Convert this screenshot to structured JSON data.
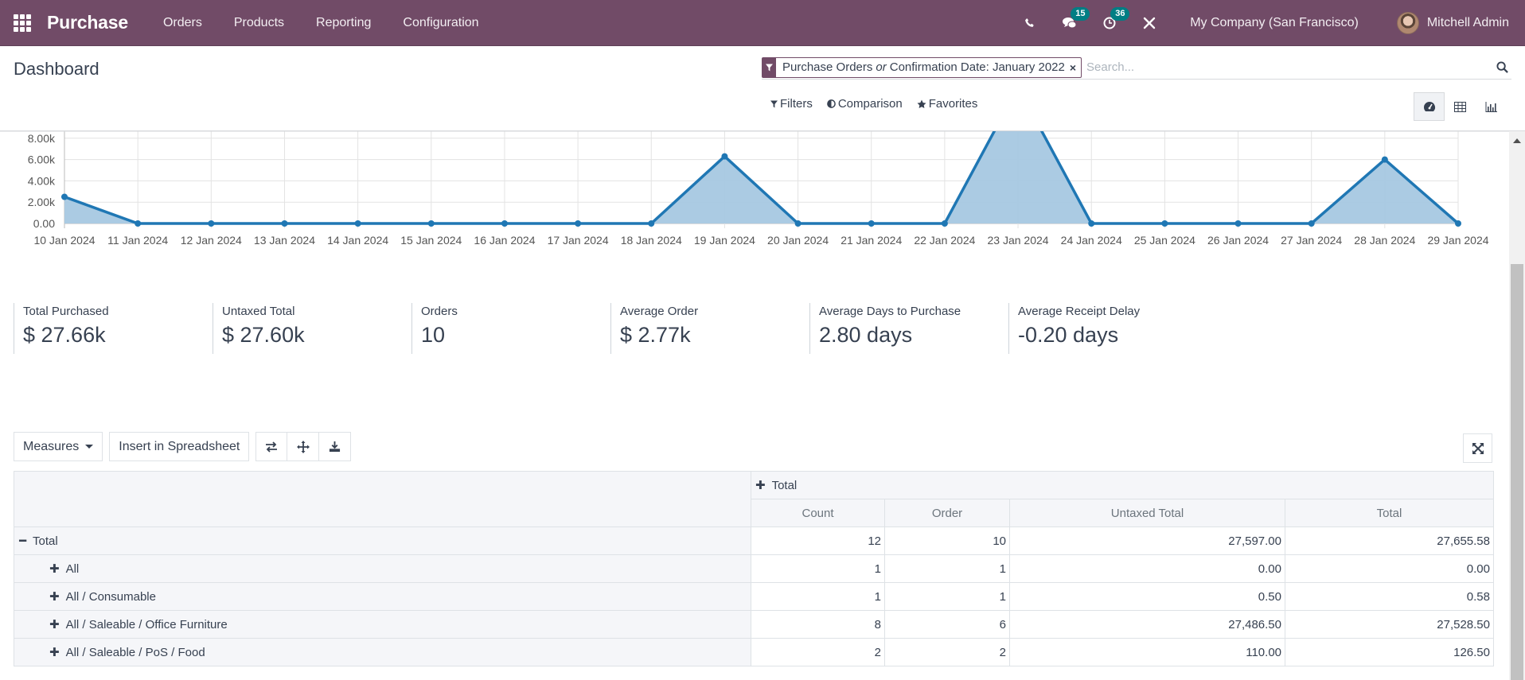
{
  "navbar": {
    "app_name": "Purchase",
    "menu": [
      "Orders",
      "Products",
      "Reporting",
      "Configuration"
    ],
    "messages_badge": "15",
    "activities_badge": "36",
    "company": "My Company (San Francisco)",
    "user": "Mitchell Admin",
    "brand_color": "#714b67"
  },
  "control_panel": {
    "title": "Dashboard",
    "facet": {
      "part1": "Purchase Orders",
      "connector": "or",
      "part2": "Confirmation Date: January 2022"
    },
    "search_placeholder": "Search...",
    "filters_label": "Filters",
    "comparison_label": "Comparison",
    "favorites_label": "Favorites",
    "views": [
      "dashboard",
      "pivot",
      "graph"
    ],
    "active_view": "dashboard"
  },
  "chart_data": {
    "type": "area",
    "title": "",
    "xlabel": "",
    "ylabel": "",
    "x": [
      "10 Jan 2024",
      "11 Jan 2024",
      "12 Jan 2024",
      "13 Jan 2024",
      "14 Jan 2024",
      "15 Jan 2024",
      "16 Jan 2024",
      "17 Jan 2024",
      "18 Jan 2024",
      "19 Jan 2024",
      "20 Jan 2024",
      "21 Jan 2024",
      "22 Jan 2024",
      "23 Jan 2024",
      "24 Jan 2024",
      "25 Jan 2024",
      "26 Jan 2024",
      "27 Jan 2024",
      "28 Jan 2024",
      "29 Jan 2024"
    ],
    "series": [
      {
        "name": "Total",
        "values": [
          2500,
          0,
          0,
          0,
          0,
          0,
          0,
          0,
          0,
          6300,
          0,
          0,
          0,
          12800,
          0,
          0,
          0,
          0,
          6000,
          0
        ],
        "color": "#1f77b4",
        "fill": "#a6c8e2"
      }
    ],
    "yticks": [
      0,
      2000,
      4000,
      6000,
      8000
    ],
    "ytick_labels": [
      "0.00",
      "2.00k",
      "4.00k",
      "6.00k",
      "8.00k"
    ],
    "ylim": [
      0,
      10000
    ],
    "grid": true,
    "legend": "none"
  },
  "kpis": [
    {
      "label": "Total Purchased",
      "value": "$ 27.66k"
    },
    {
      "label": "Untaxed Total",
      "value": "$ 27.60k"
    },
    {
      "label": "Orders",
      "value": "10"
    },
    {
      "label": "Average Order",
      "value": "$ 2.77k"
    },
    {
      "label": "Average Days to Purchase",
      "value": "2.80 days"
    },
    {
      "label": "Average Receipt Delay",
      "value": "-0.20 days"
    }
  ],
  "pivot_toolbar": {
    "measures_label": "Measures",
    "insert_label": "Insert in Spreadsheet"
  },
  "pivot": {
    "col_group": "Total",
    "measures": [
      "Count",
      "Order",
      "Untaxed Total",
      "Total"
    ],
    "rows": [
      {
        "label": "Total",
        "expanded": true,
        "level": 0,
        "values": [
          "12",
          "10",
          "27,597.00",
          "27,655.58"
        ]
      },
      {
        "label": "All",
        "expanded": false,
        "level": 1,
        "values": [
          "1",
          "1",
          "0.00",
          "0.00"
        ]
      },
      {
        "label": "All / Consumable",
        "expanded": false,
        "level": 1,
        "values": [
          "1",
          "1",
          "0.50",
          "0.58"
        ]
      },
      {
        "label": "All / Saleable / Office Furniture",
        "expanded": false,
        "level": 1,
        "values": [
          "8",
          "6",
          "27,486.50",
          "27,528.50"
        ]
      },
      {
        "label": "All / Saleable / PoS / Food",
        "expanded": false,
        "level": 1,
        "values": [
          "2",
          "2",
          "110.00",
          "126.50"
        ]
      }
    ]
  }
}
